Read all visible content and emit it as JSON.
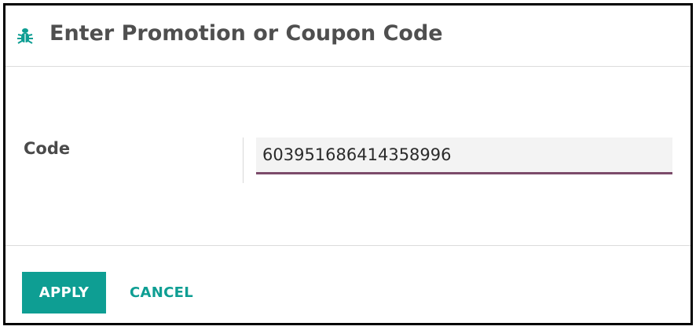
{
  "dialog": {
    "title": "Enter Promotion or Coupon Code",
    "header_icon": "bug-icon",
    "accent_color": "#0e9e93",
    "input_underline_color": "#7c4b6a"
  },
  "form": {
    "code_label": "Code",
    "code_value": "603951686414358996​"
  },
  "footer": {
    "apply_label": "APPLY",
    "cancel_label": "CANCEL"
  }
}
